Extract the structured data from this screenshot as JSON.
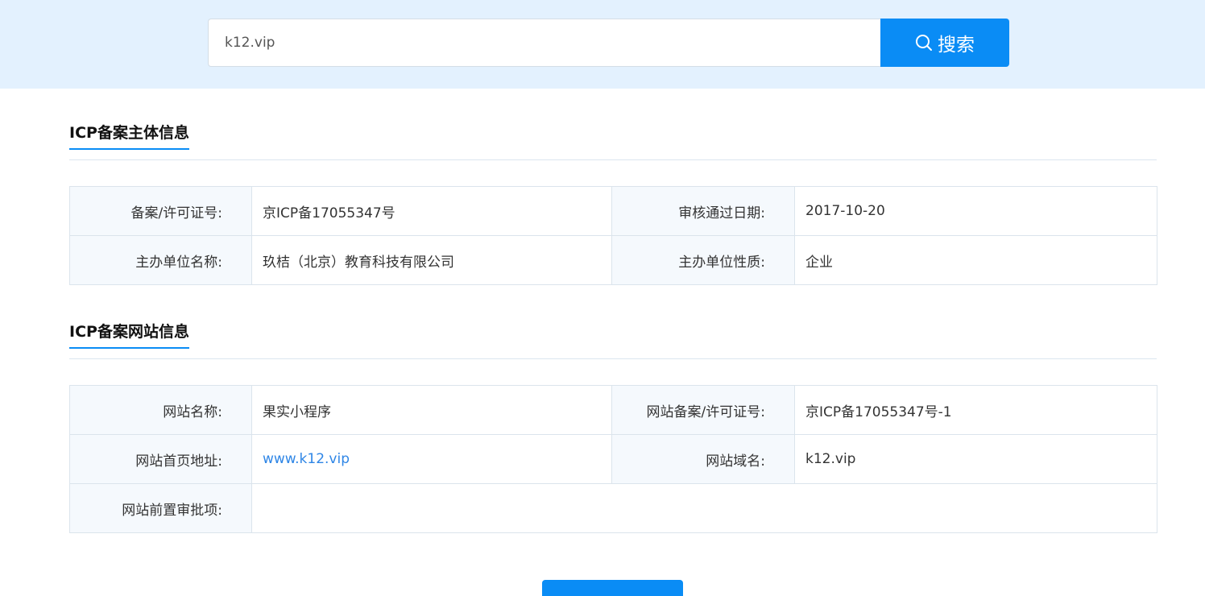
{
  "search": {
    "value": "k12.vip",
    "button_label": "搜索",
    "icon": "search-icon"
  },
  "subject_section": {
    "title": "ICP备案主体信息",
    "rows": [
      {
        "label1": "备案/许可证号:",
        "value1": "京ICP备17055347号",
        "label2": "审核通过日期:",
        "value2": "2017-10-20"
      },
      {
        "label1": "主办单位名称:",
        "value1": "玖桔（北京）教育科技有限公司",
        "label2": "主办单位性质:",
        "value2": "企业"
      }
    ]
  },
  "website_section": {
    "title": "ICP备案网站信息",
    "rows": [
      {
        "label1": "网站名称:",
        "value1": "果实小程序",
        "label2": "网站备案/许可证号:",
        "value2": "京ICP备17055347号-1"
      },
      {
        "label1": "网站首页地址:",
        "value1": "www.k12.vip",
        "label2": "网站域名:",
        "value2": "k12.vip"
      },
      {
        "label1": "网站前置审批项:",
        "value1": ""
      }
    ]
  },
  "colors": {
    "accent": "#0a8cf5",
    "topbar_bg": "#e3f1fe",
    "label_bg": "#f5f9fd",
    "link": "#2f86e6"
  }
}
